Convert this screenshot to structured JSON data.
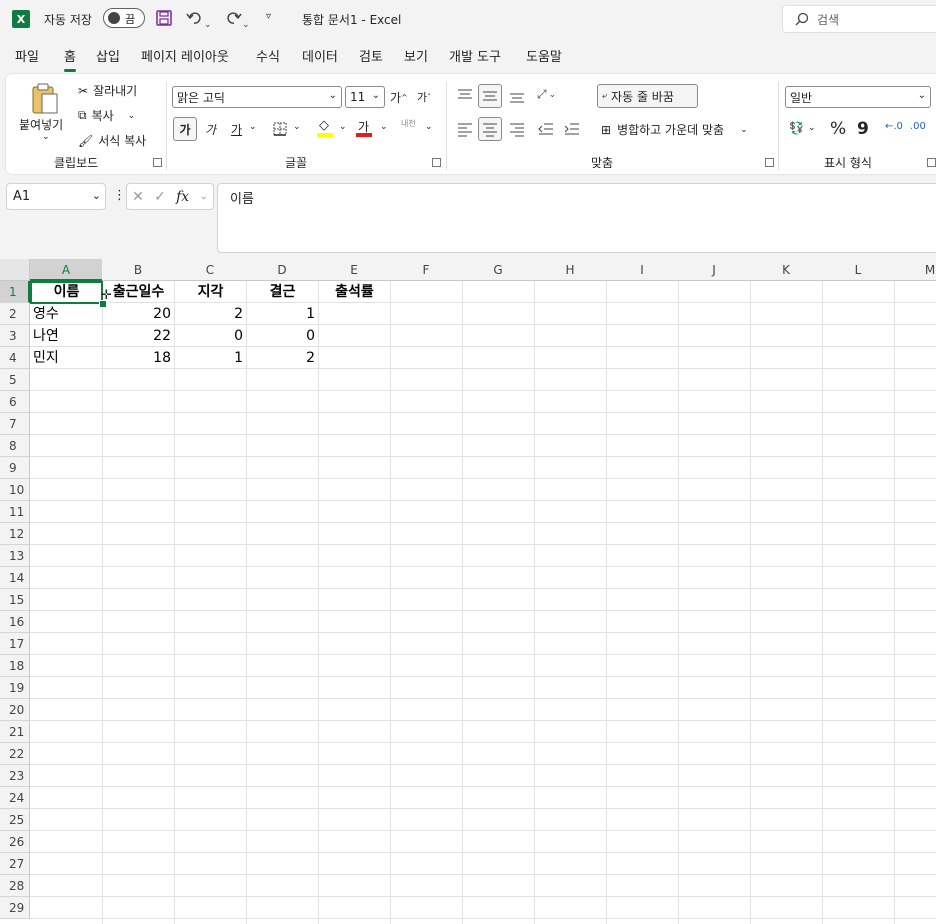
{
  "titlebar": {
    "autosave_label": "자동 저장",
    "autosave_state": "끔",
    "doc_title": "통합 문서1  -  Excel",
    "search_placeholder": "검색",
    "icons": [
      "excel-icon",
      "save-icon",
      "undo-icon",
      "redo-icon",
      "customize-qat-icon",
      "search-icon"
    ]
  },
  "menu": {
    "tabs": [
      "파일",
      "홈",
      "삽입",
      "페이지 레이아웃",
      "수식",
      "데이터",
      "검토",
      "보기",
      "개발 도구",
      "도움말"
    ],
    "active": "홈"
  },
  "ribbon": {
    "clipboard": {
      "paste": "붙여넣기",
      "cut": "잘라내기",
      "copy": "복사",
      "format_painter": "서식 복사",
      "group": "클립보드"
    },
    "font": {
      "font_name": "맑은 고딕",
      "font_size": "11",
      "grow": "가",
      "shrink": "가",
      "bold": "가",
      "italic": "가",
      "underline": "가",
      "font_color": "가",
      "phonetic": "내천",
      "group": "글꼴",
      "highlight_color": "#ffff00",
      "font_color_value": "#e02020"
    },
    "alignment": {
      "wrap_text": "자동 줄 바꿈",
      "merge_center": "병합하고 가운데 맞춤",
      "group": "맞춤"
    },
    "number": {
      "format": "일반",
      "percent": "%",
      "comma": "9",
      "group": "표시 형식"
    }
  },
  "formula_bar": {
    "name_box": "A1",
    "fx": "fx",
    "value": "이름"
  },
  "sheet": {
    "columns": [
      "A",
      "B",
      "C",
      "D",
      "E",
      "F",
      "G",
      "H",
      "I",
      "J",
      "K",
      "L",
      "M"
    ],
    "row_count": 29,
    "selected_cell": "A1",
    "accent": "#107c41",
    "headers": [
      "이름",
      "출근일수",
      "지각",
      "결근",
      "출석률"
    ],
    "rows": [
      [
        "영수",
        "20",
        "2",
        "1",
        ""
      ],
      [
        "나연",
        "22",
        "0",
        "0",
        ""
      ],
      [
        "민지",
        "18",
        "1",
        "2",
        ""
      ]
    ]
  }
}
